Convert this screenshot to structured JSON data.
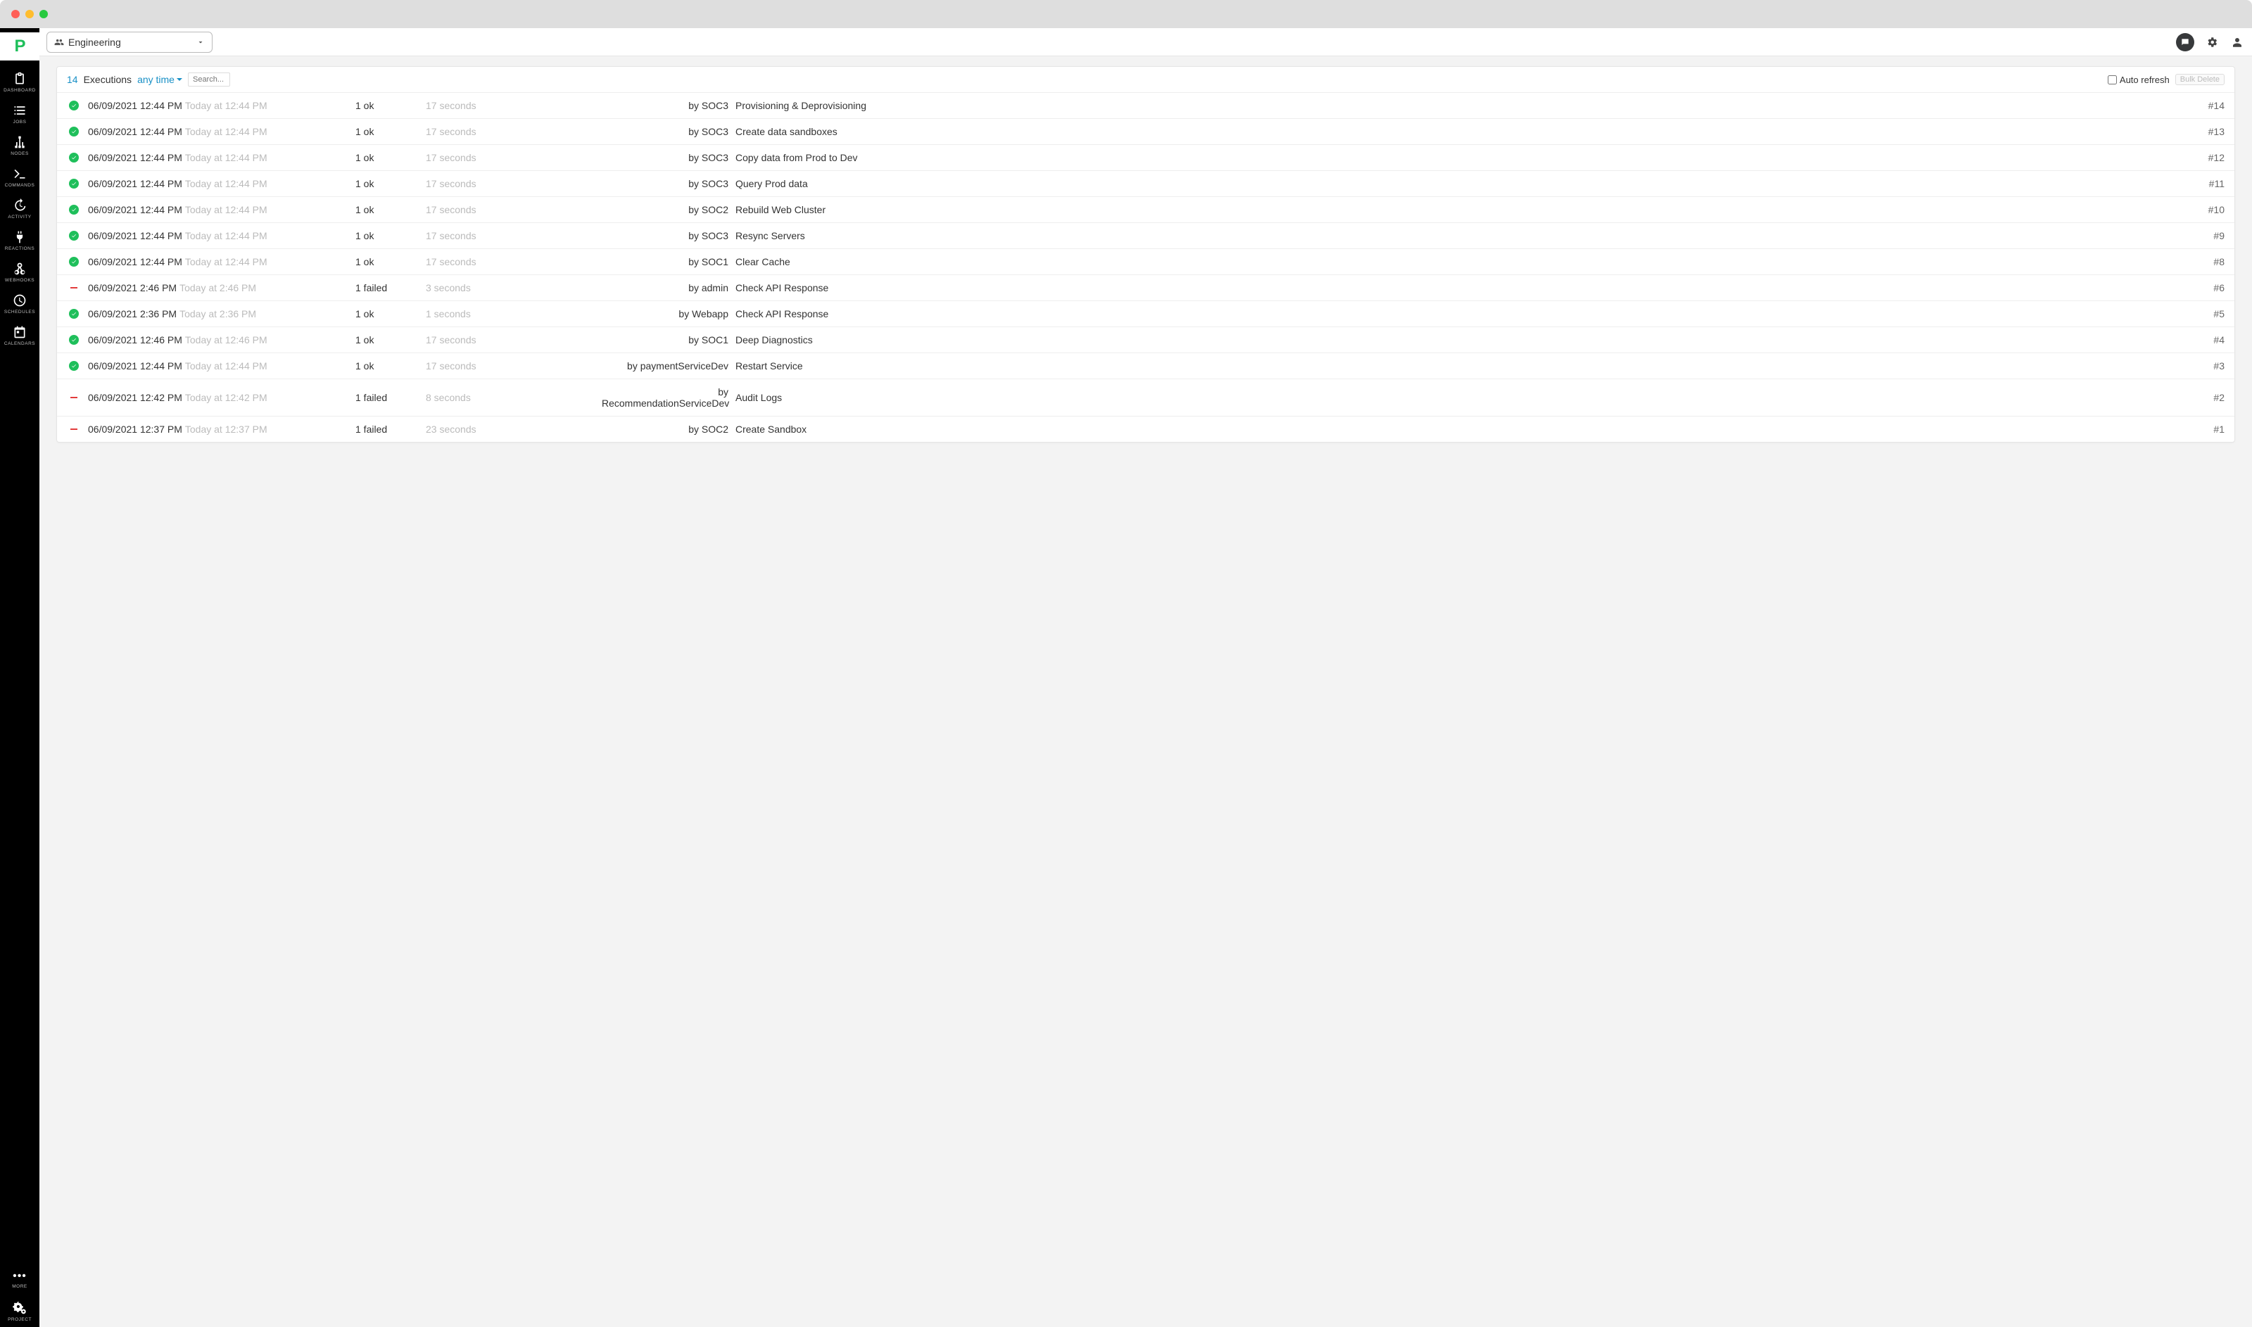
{
  "topbar": {
    "project_name": "Engineering"
  },
  "sidebar": {
    "items": [
      {
        "label": "DASHBOARD",
        "icon": "clipboard"
      },
      {
        "label": "JOBS",
        "icon": "list"
      },
      {
        "label": "NODES",
        "icon": "sitemap"
      },
      {
        "label": "COMMANDS",
        "icon": "terminal"
      },
      {
        "label": "ACTIVITY",
        "icon": "history"
      },
      {
        "label": "REACTIONS",
        "icon": "plug"
      },
      {
        "label": "WEBHOOKS",
        "icon": "webhook"
      },
      {
        "label": "SCHEDULES",
        "icon": "clock"
      },
      {
        "label": "CALENDARS",
        "icon": "calendar"
      }
    ],
    "more_label": "MORE",
    "project_label": "PROJECT"
  },
  "header": {
    "count": "14",
    "title": "Executions",
    "time_filter": "any time",
    "search_placeholder": "Search...",
    "auto_refresh_label": "Auto refresh",
    "bulk_delete_label": "Bulk Delete"
  },
  "executions": [
    {
      "status": "ok",
      "datetime": "06/09/2021 12:44 PM",
      "relative": "Today at 12:44 PM",
      "outcome": "1 ok",
      "duration": "17 seconds",
      "user": "by SOC3",
      "job": "Provisioning & Deprovisioning",
      "idx": "#14"
    },
    {
      "status": "ok",
      "datetime": "06/09/2021 12:44 PM",
      "relative": "Today at 12:44 PM",
      "outcome": "1 ok",
      "duration": "17 seconds",
      "user": "by SOC3",
      "job": "Create data sandboxes",
      "idx": "#13"
    },
    {
      "status": "ok",
      "datetime": "06/09/2021 12:44 PM",
      "relative": "Today at 12:44 PM",
      "outcome": "1 ok",
      "duration": "17 seconds",
      "user": "by SOC3",
      "job": "Copy data from Prod to Dev",
      "idx": "#12"
    },
    {
      "status": "ok",
      "datetime": "06/09/2021 12:44 PM",
      "relative": "Today at 12:44 PM",
      "outcome": "1 ok",
      "duration": "17 seconds",
      "user": "by SOC3",
      "job": "Query Prod data",
      "idx": "#11"
    },
    {
      "status": "ok",
      "datetime": "06/09/2021 12:44 PM",
      "relative": "Today at 12:44 PM",
      "outcome": "1 ok",
      "duration": "17 seconds",
      "user": "by SOC2",
      "job": "Rebuild Web Cluster",
      "idx": "#10"
    },
    {
      "status": "ok",
      "datetime": "06/09/2021 12:44 PM",
      "relative": "Today at 12:44 PM",
      "outcome": "1 ok",
      "duration": "17 seconds",
      "user": "by SOC3",
      "job": "Resync Servers",
      "idx": "#9"
    },
    {
      "status": "ok",
      "datetime": "06/09/2021 12:44 PM",
      "relative": "Today at 12:44 PM",
      "outcome": "1 ok",
      "duration": "17 seconds",
      "user": "by SOC1",
      "job": "Clear Cache",
      "idx": "#8"
    },
    {
      "status": "fail",
      "datetime": "06/09/2021 2:46 PM",
      "relative": "Today at 2:46 PM",
      "outcome": "1 failed",
      "duration": "3 seconds",
      "user": "by admin",
      "job": "Check API Response",
      "idx": "#6"
    },
    {
      "status": "ok",
      "datetime": "06/09/2021 2:36 PM",
      "relative": "Today at 2:36 PM",
      "outcome": "1 ok",
      "duration": "1 seconds",
      "user": "by Webapp",
      "job": "Check API Response",
      "idx": "#5"
    },
    {
      "status": "ok",
      "datetime": "06/09/2021 12:46 PM",
      "relative": "Today at 12:46 PM",
      "outcome": "1 ok",
      "duration": "17 seconds",
      "user": "by SOC1",
      "job": "Deep Diagnostics",
      "idx": "#4"
    },
    {
      "status": "ok",
      "datetime": "06/09/2021 12:44 PM",
      "relative": "Today at 12:44 PM",
      "outcome": "1 ok",
      "duration": "17 seconds",
      "user": "by paymentServiceDev",
      "job": "Restart Service",
      "idx": "#3"
    },
    {
      "status": "fail",
      "datetime": "06/09/2021 12:42 PM",
      "relative": "Today at 12:42 PM",
      "outcome": "1 failed",
      "duration": "8 seconds",
      "user": "by RecommendationServiceDev",
      "job": "Audit Logs",
      "idx": "#2"
    },
    {
      "status": "fail",
      "datetime": "06/09/2021 12:37 PM",
      "relative": "Today at 12:37 PM",
      "outcome": "1 failed",
      "duration": "23 seconds",
      "user": "by SOC2",
      "job": "Create Sandbox",
      "idx": "#1"
    }
  ]
}
